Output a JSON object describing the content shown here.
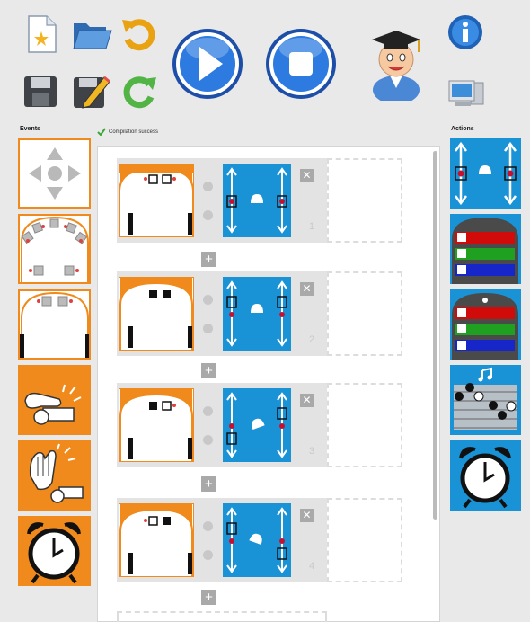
{
  "toolbar": {
    "icons": [
      "new-file-icon",
      "open-folder-icon",
      "undo-icon",
      "save-icon",
      "edit-icon",
      "redo-icon",
      "run-icon",
      "stop-icon",
      "teacher-icon",
      "info-icon",
      "computer-icon"
    ]
  },
  "labels": {
    "events": "Events",
    "actions": "Actions",
    "status": "Compilation success"
  },
  "events": [
    {
      "name": "buttons-event"
    },
    {
      "name": "front-proximity-event"
    },
    {
      "name": "ground-sensor-event"
    },
    {
      "name": "tap-event"
    },
    {
      "name": "clap-event"
    },
    {
      "name": "timer-event"
    }
  ],
  "actions": [
    {
      "name": "motors-action"
    },
    {
      "name": "top-colors-action"
    },
    {
      "name": "bottom-colors-action"
    },
    {
      "name": "music-action"
    },
    {
      "name": "timer-action"
    }
  ],
  "pairs": [
    {
      "number": "1"
    },
    {
      "number": "2"
    },
    {
      "number": "3"
    },
    {
      "number": "4"
    }
  ],
  "colors": {
    "orange": "#f08a1c",
    "blue": "#1a93d6",
    "gray": "#a9a9a9",
    "success": "#3aa635"
  }
}
